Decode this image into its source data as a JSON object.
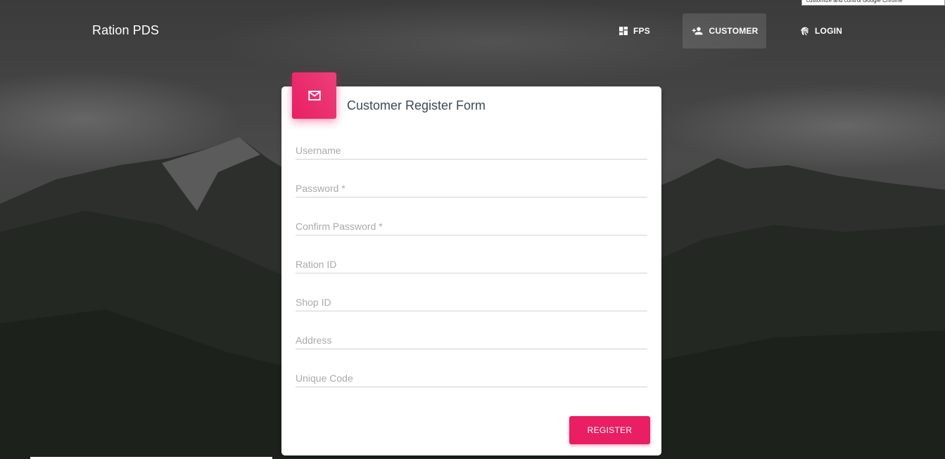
{
  "navbar": {
    "brand": "Ration PDS",
    "items": [
      {
        "label": "FPS",
        "icon": "dashboard-icon",
        "active": false
      },
      {
        "label": "CUSTOMER",
        "icon": "person-add-icon",
        "active": true
      },
      {
        "label": "LOGIN",
        "icon": "fingerprint-icon",
        "active": false
      }
    ]
  },
  "tooltip": {
    "text": "customize and control Google Chrome"
  },
  "card": {
    "title": "Customer Register Form",
    "icon": "mail-icon",
    "fields": [
      {
        "placeholder": "Username",
        "value": ""
      },
      {
        "placeholder": "Password *",
        "value": ""
      },
      {
        "placeholder": "Confirm Password *",
        "value": ""
      },
      {
        "placeholder": "Ration ID",
        "value": ""
      },
      {
        "placeholder": "Shop ID",
        "value": ""
      },
      {
        "placeholder": "Address",
        "value": ""
      },
      {
        "placeholder": "Unique Code",
        "value": ""
      }
    ],
    "submit_label": "REGISTER"
  },
  "colors": {
    "accent": "#e91e63",
    "title_text": "#3c4858",
    "placeholder": "#aaaaaa"
  }
}
